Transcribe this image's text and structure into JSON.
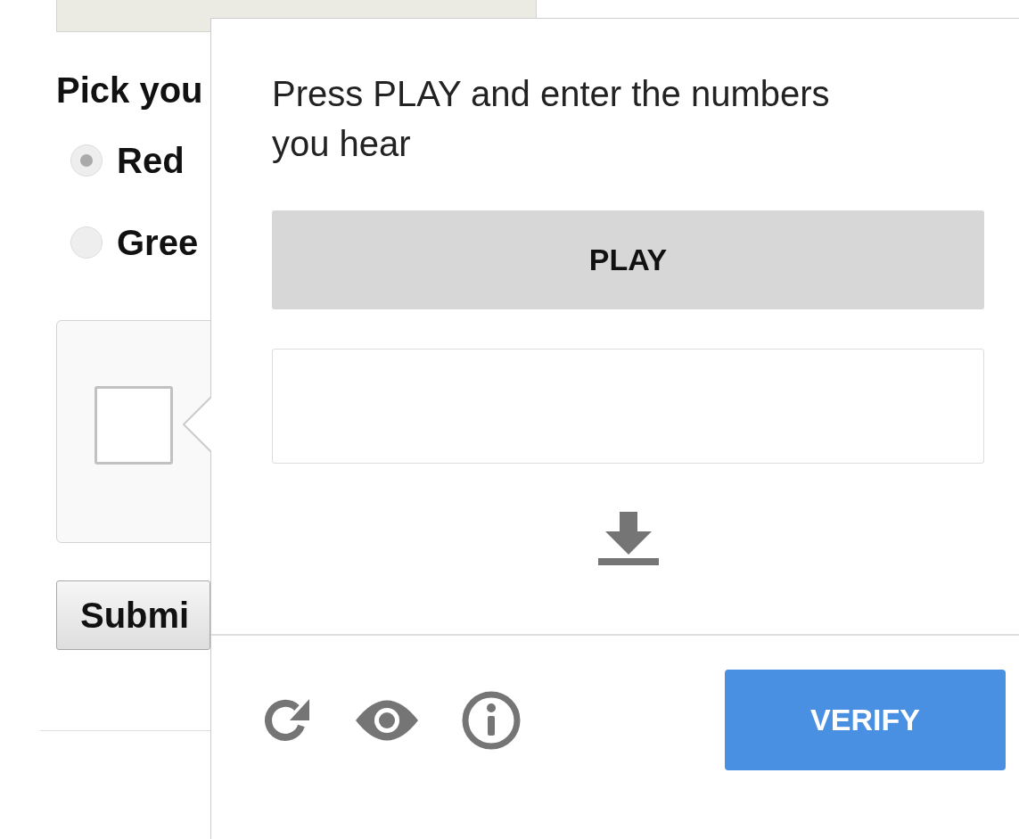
{
  "form": {
    "heading": "Pick you",
    "radios": [
      {
        "label": "Red",
        "selected": true
      },
      {
        "label": "Gree",
        "selected": false
      }
    ],
    "captcha_checkbox": {
      "checked": false
    },
    "submit_button": "Submi"
  },
  "challenge": {
    "instruction": "Press PLAY and enter the numbers you hear",
    "play_button": "PLAY",
    "verify_button": "VERIFY"
  }
}
